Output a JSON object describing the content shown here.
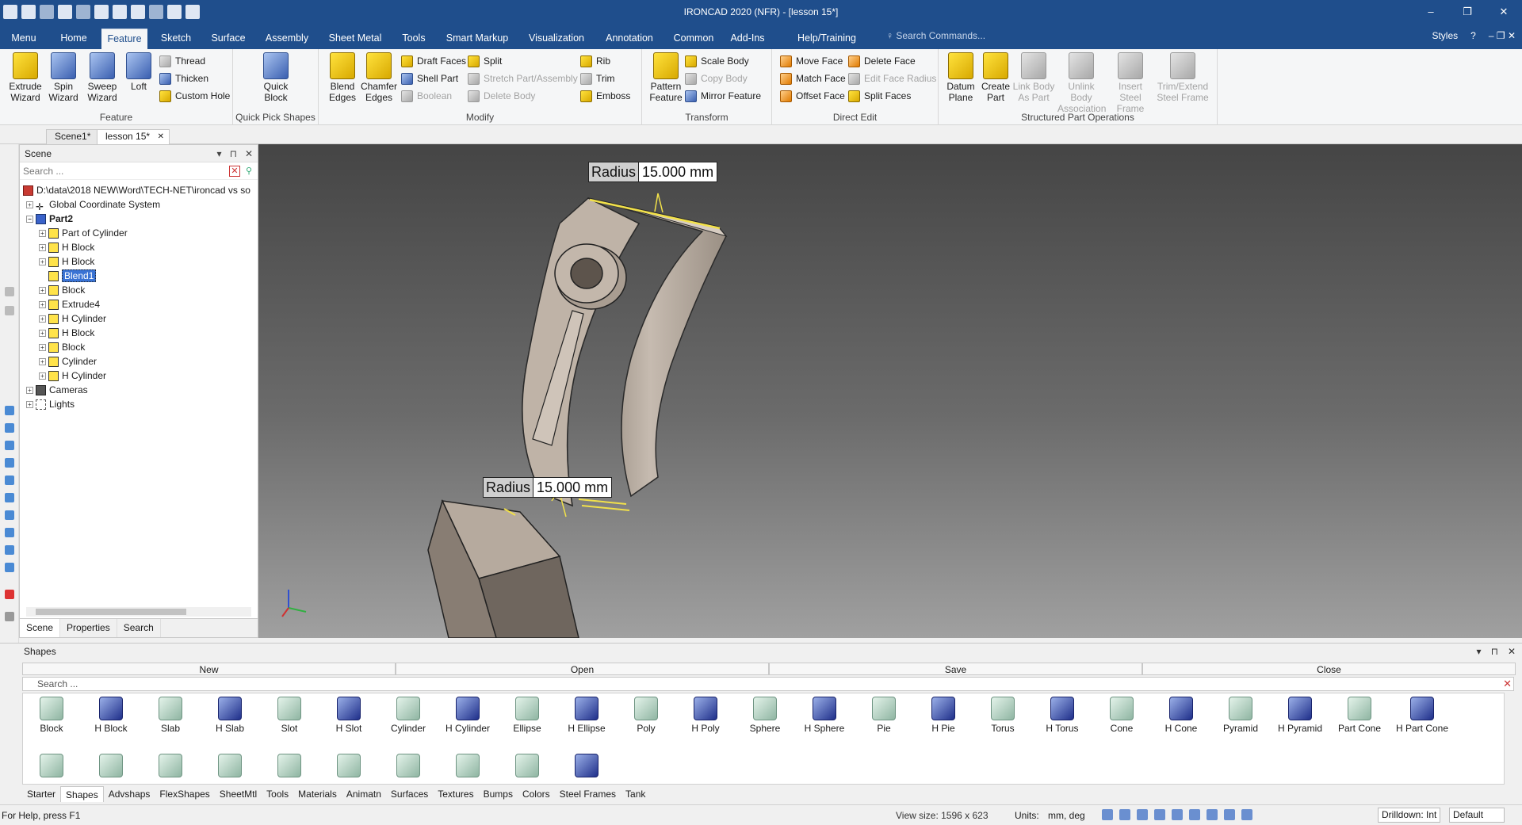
{
  "window": {
    "title": "IRONCAD 2020 (NFR) - [lesson 15*]",
    "minimize": "–",
    "maximize": "❐",
    "close": "✕"
  },
  "menu": {
    "tabs": [
      "Menu",
      "Home",
      "Feature",
      "Sketch",
      "Surface",
      "Assembly",
      "Sheet Metal",
      "Tools",
      "Smart Markup",
      "Visualization",
      "Annotation",
      "Common",
      "Add-Ins",
      "Help/Training"
    ],
    "active": "Feature",
    "search_placeholder": "Search Commands...",
    "styles": "Styles",
    "help": "?",
    "mdi_controls": "–  ❐  ✕"
  },
  "ribbon": {
    "feature": {
      "title": "Feature",
      "extrude": "Extrude Wizard",
      "spin": "Spin Wizard",
      "sweep": "Sweep Wizard",
      "loft": "Loft",
      "thread": "Thread",
      "thicken": "Thicken",
      "custom_hole": "Custom Hole"
    },
    "quickpick": {
      "title": "Quick Pick Shapes",
      "quick_block": "Quick Block"
    },
    "modify": {
      "title": "Modify",
      "blend": "Blend Edges",
      "chamfer": "Chamfer Edges",
      "draft": "Draft Faces",
      "shell": "Shell Part",
      "boolean": "Boolean",
      "split": "Split",
      "stretch": "Stretch Part/Assembly",
      "delete_body": "Delete Body",
      "rib": "Rib",
      "trim": "Trim",
      "emboss": "Emboss"
    },
    "transform": {
      "title": "Transform",
      "pattern": "Pattern Feature",
      "scale": "Scale Body",
      "copy": "Copy Body",
      "mirror": "Mirror Feature"
    },
    "directedit": {
      "title": "Direct Edit",
      "move_face": "Move Face",
      "match_face": "Match Face",
      "offset_face": "Offset Face",
      "delete_face": "Delete Face",
      "edit_radius": "Edit Face Radius",
      "split_faces": "Split Faces"
    },
    "structured": {
      "title": "Structured Part Operations",
      "datum": "Datum Plane",
      "create_part": "Create Part",
      "link_body": "Link Body As Part",
      "unlink": "Unlink Body Association",
      "insert_steel": "Insert Steel Frame",
      "trim_steel": "Trim/Extend Steel Frame"
    }
  },
  "doctabs": [
    "Scene1*",
    "lesson 15*"
  ],
  "doctab_close": "✕",
  "scene": {
    "title": "Scene",
    "search_placeholder": "Search ...",
    "root": "D:\\data\\2018 NEW\\Word\\TECH-NET\\ironcad vs so",
    "items": [
      "Global Coordinate System",
      "Part2",
      "Part of Cylinder",
      "H Block",
      "H Block",
      "Blend1",
      "Block",
      "Extrude4",
      "H Cylinder",
      "H Block",
      "Block",
      "Cylinder",
      "H Cylinder",
      "Cameras",
      "Lights"
    ],
    "selected": "Blend1",
    "tabs": [
      "Scene",
      "Properties",
      "Search"
    ]
  },
  "viewport": {
    "dim_top": {
      "label": "Radius",
      "value": "15.000 mm"
    },
    "dim_bottom": {
      "label": "Radius",
      "value": "15.000 mm"
    },
    "part_color": "#b3a79b"
  },
  "shapes": {
    "title": "Shapes",
    "actions": [
      "New",
      "Open",
      "Save",
      "Close"
    ],
    "search_placeholder": "Search ...",
    "row1": [
      "Block",
      "H Block",
      "Slab",
      "H Slab",
      "Slot",
      "H Slot",
      "Cylinder",
      "H Cylinder",
      "Ellipse",
      "H Ellipse",
      "Poly",
      "H Poly",
      "Sphere",
      "H Sphere",
      "Pie",
      "H Pie",
      "Torus",
      "H Torus",
      "Cone",
      "H Cone",
      "Pyramid",
      "H Pyramid",
      "Part Cone",
      "H Part Cone"
    ],
    "tabs": [
      "Starter",
      "Shapes",
      "Advshaps",
      "FlexShapes",
      "SheetMtl",
      "Tools",
      "Materials",
      "Animatn",
      "Surfaces",
      "Textures",
      "Bumps",
      "Colors",
      "Steel Frames",
      "Tank"
    ],
    "active_tab": "Shapes"
  },
  "status": {
    "help": "For Help, press F1",
    "view_size": "View size: 1596 x  623",
    "units_label": "Units:",
    "units": "mm, deg",
    "drilldown": "Drilldown: Int",
    "mode": "Default"
  }
}
